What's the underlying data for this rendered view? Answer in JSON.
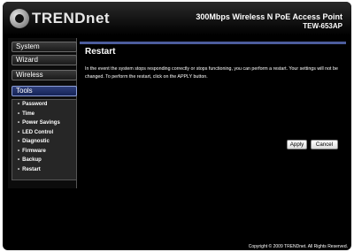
{
  "brand": {
    "logo_text": "TRENDnet"
  },
  "product": {
    "name": "300Mbps Wireless N PoE Access Point",
    "model": "TEW-653AP"
  },
  "sidebar": {
    "menus": [
      "System",
      "Wizard",
      "Wireless",
      "Tools"
    ],
    "tools_items": [
      "Password",
      "Time",
      "Power Savings",
      "LED Control",
      "Diagnostic",
      "Firmware",
      "Backup",
      "Restart"
    ]
  },
  "main": {
    "title": "Restart",
    "description": "In the event the system stops responding correctly or stops functioning, you can perform a restart. Your settings will not be changed. To perform the restart, click on the APPLY button.",
    "apply_label": "Apply",
    "cancel_label": "Cancel"
  },
  "footer": {
    "copyright": "Copyright © 2009 TRENDnet. All Rights Reserved."
  }
}
